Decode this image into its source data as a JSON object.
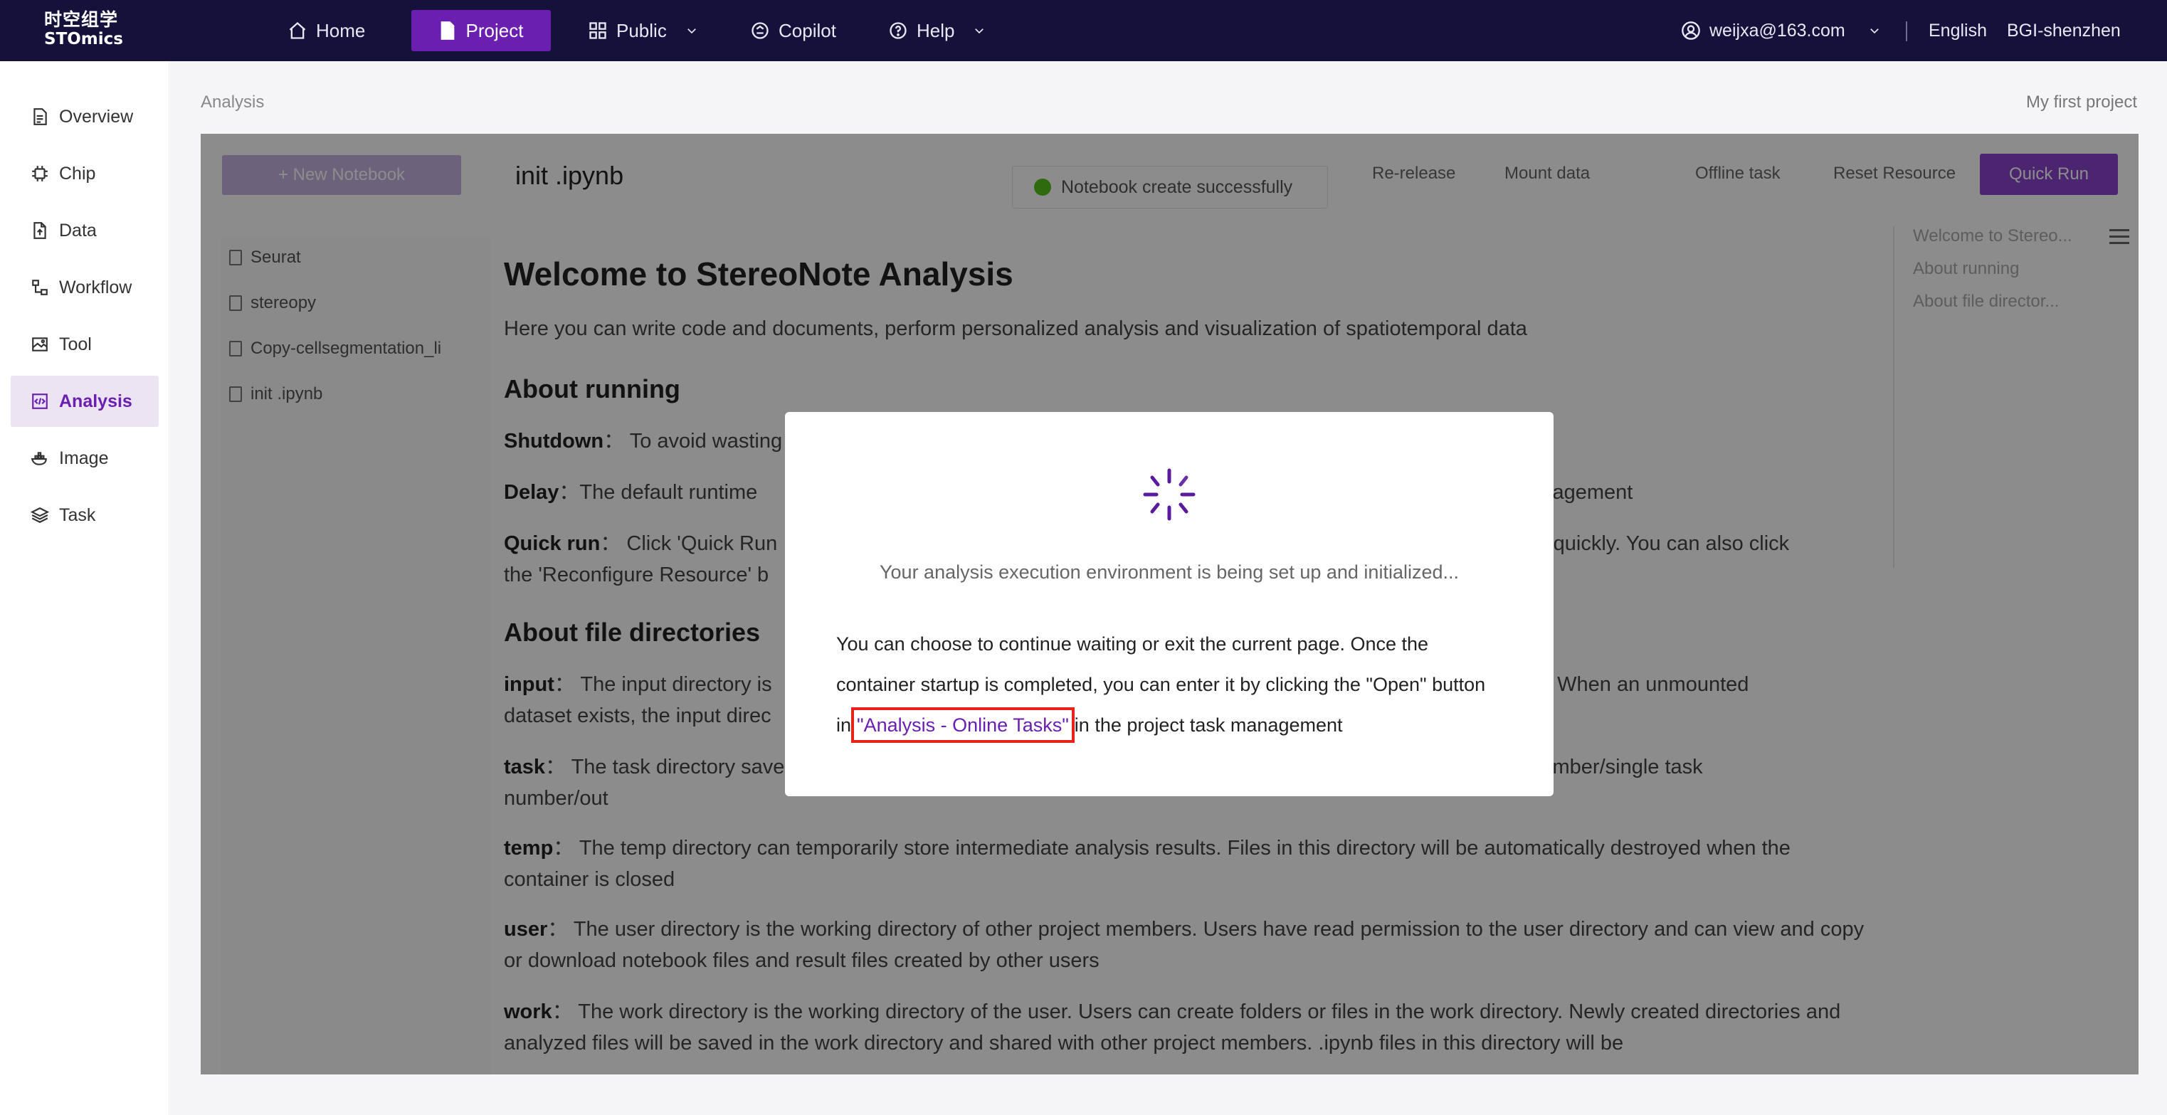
{
  "brand": {
    "name_cn": "时空组学",
    "name_en": "STOmics"
  },
  "topnav": {
    "home": "Home",
    "project": "Project",
    "public": "Public",
    "copilot": "Copilot",
    "help": "Help",
    "user": "weijxa@163.com",
    "language": "English",
    "region": "BGI-shenzhen"
  },
  "sidebar": {
    "items": [
      {
        "label": "Overview",
        "icon": "document-icon"
      },
      {
        "label": "Chip",
        "icon": "chip-icon"
      },
      {
        "label": "Data",
        "icon": "file-upload-icon"
      },
      {
        "label": "Workflow",
        "icon": "workflow-icon"
      },
      {
        "label": "Tool",
        "icon": "image-tool-icon"
      },
      {
        "label": "Analysis",
        "icon": "code-icon"
      },
      {
        "label": "Image",
        "icon": "docker-icon"
      },
      {
        "label": "Task",
        "icon": "layers-icon"
      }
    ],
    "active": "Analysis"
  },
  "breadcrumb": "Analysis",
  "project_name": "My first project",
  "notebook": {
    "new_button": "+ New Notebook",
    "title": "init .ipynb",
    "toast": "Notebook create successfully",
    "toolbar": {
      "re_release": "Re-release",
      "mount_data": "Mount data",
      "offline_task": "Offline task",
      "reset_resource": "Reset Resource",
      "quick_run": "Quick Run"
    },
    "files": [
      "Seurat",
      "stereopy",
      "Copy-cellsegmentation_li",
      "init .ipynb"
    ],
    "toc": [
      "Welcome to Stereo...",
      "About running",
      "About file director..."
    ]
  },
  "doc": {
    "h1": "Welcome to StereoNote Analysis",
    "intro": "Here you can write code and documents, perform personalized analysis and visualization of spatiotemporal data",
    "h2_running": "About running",
    "shutdown_label": "Shutdown",
    "shutdown_text": "To avoid wasting",
    "delay_label": "Delay",
    "delay_text": "The default runtime",
    "delay_tail": "sk management",
    "quick_label": "Quick run",
    "quick_text": "Click 'Quick Run",
    "quick_tail": "o start quickly. You can also click",
    "quick_line2": "the 'Reconfigure Resource' b",
    "h2_dirs": "About file directories",
    "input_label": "input",
    "input_text": "The input directory is",
    "input_tail": "here. When an unmounted",
    "input_line2": "dataset exists, the input direc",
    "task_label": "task",
    "task_text": "The task directory save",
    "task_tail": "task number/single task",
    "task_line2": "number/out",
    "temp_label": "temp",
    "temp_text": "The temp directory can temporarily store intermediate analysis results. Files in this directory will be automatically destroyed when the container is closed",
    "user_label": "user",
    "user_text": "The user directory is the working directory of other project members. Users have read permission to the user directory and can view and copy or download notebook files and result files created by other users",
    "work_label": "work",
    "work_text": "The work directory is the working directory of the user. Users can create folders or files in the work directory. Newly created directories and analyzed files will be saved in the work directory and shared with other project members. .ipynb files in this directory will be"
  },
  "modal": {
    "status": "Your analysis execution environment is being set up and initialized...",
    "body_before": "You can choose to continue waiting or exit the current page. Once the container startup is completed, you can enter it by clicking the \"Open\" button in",
    "link": "\"Analysis - Online Tasks\"",
    "body_after": "in the project task management"
  },
  "colors": {
    "topbar": "#15113a",
    "accent": "#6a1fb0",
    "highlight_border": "#e8221b"
  }
}
